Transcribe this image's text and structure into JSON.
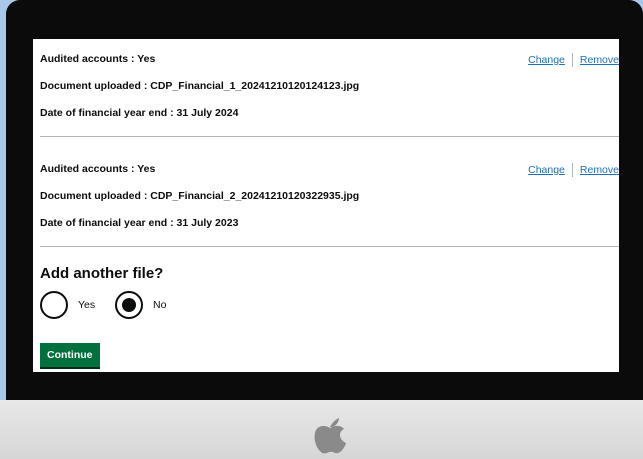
{
  "records": [
    {
      "audited_label": "Audited accounts : Yes",
      "document_label": "Document uploaded : CDP_Financial_1_20241210120124123.jpg",
      "date_label": "Date of financial year end : 31 July 2024",
      "change_label": "Change",
      "remove_label": "Remove"
    },
    {
      "audited_label": "Audited accounts : Yes",
      "document_label": "Document uploaded : CDP_Financial_2_20241210120322935.jpg",
      "date_label": "Date of financial year end : 31 July 2023",
      "change_label": "Change",
      "remove_label": "Remove"
    }
  ],
  "question": {
    "title": "Add another file?",
    "options": [
      {
        "label": "Yes",
        "selected": false
      },
      {
        "label": "No",
        "selected": true
      }
    ]
  },
  "continue_label": "Continue",
  "colors": {
    "link": "#1d70b8",
    "button": "#00703c",
    "text": "#0b0c0c",
    "background": "#a9c7e8"
  },
  "icons": [
    "apple-logo-icon"
  ]
}
